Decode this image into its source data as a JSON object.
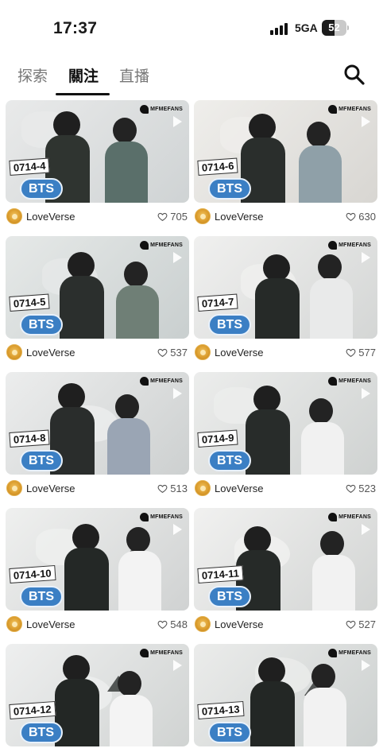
{
  "status": {
    "time": "17:37",
    "network": "5GA",
    "battery": "52"
  },
  "tabs": [
    {
      "label": "探索",
      "active": false
    },
    {
      "label": "關注",
      "active": true
    },
    {
      "label": "直播",
      "active": false
    }
  ],
  "watermark": "MFMEFANS",
  "badge_label": "BTS",
  "cards": [
    {
      "code": "0714-4",
      "author": "LoveVerse",
      "likes": "705"
    },
    {
      "code": "0714-6",
      "author": "LoveVerse",
      "likes": "630"
    },
    {
      "code": "0714-5",
      "author": "LoveVerse",
      "likes": "537"
    },
    {
      "code": "0714-7",
      "author": "LoveVerse",
      "likes": "577"
    },
    {
      "code": "0714-8",
      "author": "LoveVerse",
      "likes": "513"
    },
    {
      "code": "0714-9",
      "author": "LoveVerse",
      "likes": "523"
    },
    {
      "code": "0714-10",
      "author": "LoveVerse",
      "likes": "548"
    },
    {
      "code": "0714-11",
      "author": "LoveVerse",
      "likes": "527"
    },
    {
      "code": "0714-12",
      "author": "",
      "likes": ""
    },
    {
      "code": "0714-13",
      "author": "",
      "likes": ""
    }
  ],
  "colors": {
    "badge": "#3b7fc4",
    "active_tab": "#111111",
    "inactive_tab": "#777777"
  }
}
